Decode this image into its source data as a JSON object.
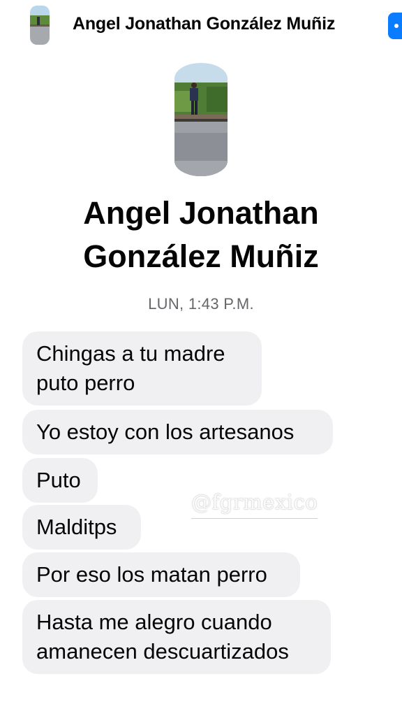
{
  "header": {
    "name": "Angel Jonathan González Muñiz"
  },
  "profile": {
    "name_line1": "Angel Jonathan",
    "name_line2": "González Muñiz"
  },
  "timestamp": "LUN, 1:43 P.M.",
  "messages": [
    {
      "lines": [
        "Chingas a tu madre",
        "puto perro"
      ]
    },
    {
      "lines": [
        "Yo estoy con los artesanos"
      ]
    },
    {
      "lines": [
        "Puto"
      ]
    },
    {
      "lines": [
        "Malditps"
      ]
    },
    {
      "lines": [
        "Por eso los matan perro"
      ]
    },
    {
      "lines": [
        "Hasta me alegro cuando",
        "amanecen descuartizados"
      ]
    }
  ],
  "watermark": "@fgrmexico",
  "colors": {
    "bubble": "#f0f0f3",
    "accent": "#0a7cff",
    "timestamp": "#65676b"
  }
}
